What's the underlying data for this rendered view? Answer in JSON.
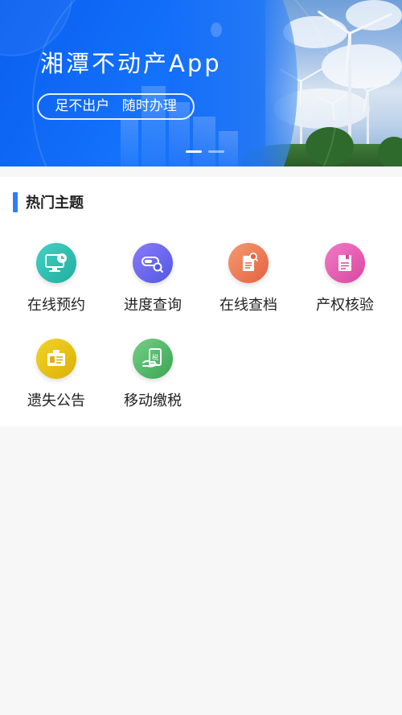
{
  "banner": {
    "title": "湘潭不动产App",
    "slogan": "足不出户 随时办理",
    "carousel_count": 2,
    "carousel_active": 1
  },
  "hot_topics": {
    "title": "热门主题",
    "accent_color": "#2f7df6",
    "items": [
      {
        "label": "在线预约",
        "icon": "monitor-clock-icon",
        "color": "#2cbfb4"
      },
      {
        "label": "进度查询",
        "icon": "progress-search-icon",
        "color": "#6a6af0"
      },
      {
        "label": "在线查档",
        "icon": "document-search-icon",
        "color": "#f07a57"
      },
      {
        "label": "产权核验",
        "icon": "certificate-icon",
        "color": "#e75bb4"
      },
      {
        "label": "遗失公告",
        "icon": "id-badge-icon",
        "color": "#e8c41a"
      },
      {
        "label": "移动缴税",
        "icon": "tax-payment-icon",
        "color": "#52bb6a"
      }
    ]
  }
}
